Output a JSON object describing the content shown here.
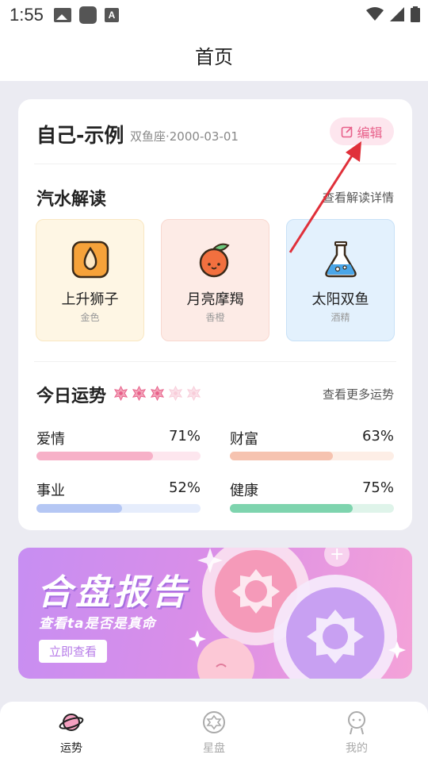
{
  "status_bar": {
    "time": "1:55"
  },
  "header": {
    "title": "首页"
  },
  "profile": {
    "name": "自己-示例",
    "meta": "双鱼座·2000-03-01",
    "edit_label": "编辑"
  },
  "reading": {
    "title": "汽水解读",
    "link": "查看解读详情",
    "cards": [
      {
        "label": "上升狮子",
        "sub": "金色",
        "icon": "juice-drop-icon",
        "bg": "#fef6e4",
        "border": "#f9e7c2"
      },
      {
        "label": "月亮摩羯",
        "sub": "香橙",
        "icon": "orange-fruit-icon",
        "bg": "#fdebe6",
        "border": "#f8d8d0"
      },
      {
        "label": "太阳双鱼",
        "sub": "酒精",
        "icon": "flask-icon",
        "bg": "#e3f1fd",
        "border": "#c8e1f7"
      }
    ]
  },
  "fortune": {
    "title": "今日运势",
    "link": "查看更多运势",
    "stars_filled": 3,
    "stars_total": 5,
    "metrics": [
      {
        "label": "爱情",
        "value": "71%",
        "fill": "#f7b1c8",
        "track": "#fde6ee"
      },
      {
        "label": "财富",
        "value": "63%",
        "fill": "#f6c3b0",
        "track": "#fdeee6"
      },
      {
        "label": "事业",
        "value": "52%",
        "fill": "#b5c7f4",
        "track": "#e6edfc"
      },
      {
        "label": "健康",
        "value": "75%",
        "fill": "#7ed4ae",
        "track": "#dff4ea"
      }
    ]
  },
  "banner": {
    "title": "合盘报告",
    "subtitle": "查看ta是否是真命",
    "button": "立即查看"
  },
  "tabbar": {
    "items": [
      {
        "label": "运势",
        "active": true
      },
      {
        "label": "星盘",
        "active": false
      },
      {
        "label": "我的",
        "active": false
      }
    ]
  },
  "colors": {
    "accent": "#e8608a",
    "arrow": "#e0303a"
  }
}
